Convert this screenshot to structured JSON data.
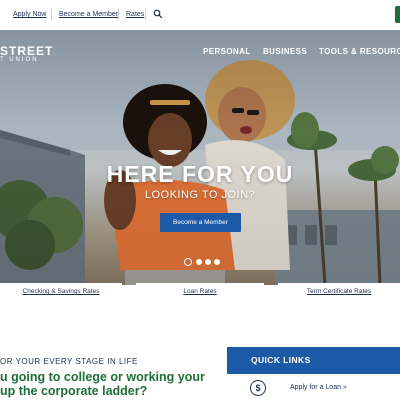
{
  "utility_nav": {
    "apply_now": "Apply Now",
    "become_member": "Become a Member",
    "rates": "Rates",
    "search_icon": "search-icon"
  },
  "logo": {
    "line1": "STREET",
    "line2": "T UNION"
  },
  "main_nav": [
    "PERSONAL",
    "BUSINESS",
    "TOOLS & RESOURCES"
  ],
  "hero": {
    "title": "HERE FOR YOU",
    "subtitle": "LOOKING TO JOIN?",
    "button": "Become a Member",
    "slides": 4,
    "active_slide": 1
  },
  "rate_tabs": [
    "Checking & Savings Rates",
    "Loan Rates",
    "Term Certificate Rates"
  ],
  "stage": {
    "heading": "OR YOUR EVERY STAGE IN LIFE",
    "question_line1": "u going to college or working your",
    "question_line2": "up the corporate ladder?"
  },
  "quick_links": {
    "title": "QUICK LINKS",
    "items": [
      {
        "label": "Apply for a Loan »",
        "icon": "dollar-circle-icon"
      }
    ]
  },
  "colors": {
    "navy": "#1d2f55",
    "blue_button": "#1c5aa7",
    "green": "#1f6e3a"
  }
}
